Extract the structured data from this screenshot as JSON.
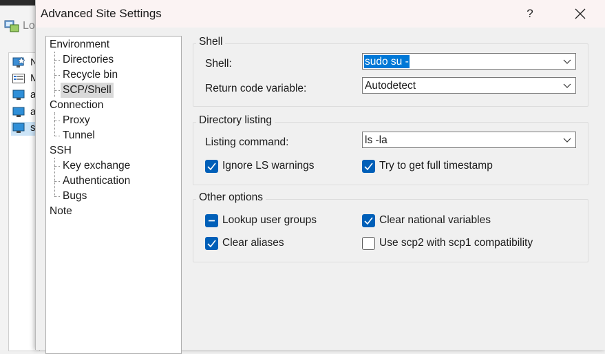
{
  "background_window": {
    "toolbar_login_label": "Lo",
    "list_items": [
      {
        "label": "N",
        "icon": "new-site-icon",
        "selected": false
      },
      {
        "label": "M",
        "icon": "manage-list-icon",
        "selected": false
      },
      {
        "label": "a",
        "icon": "computer-icon",
        "selected": false
      },
      {
        "label": "a",
        "icon": "computer-icon",
        "selected": false
      },
      {
        "label": "s",
        "icon": "computer-icon",
        "selected": true
      }
    ]
  },
  "dialog": {
    "title": "Advanced Site Settings",
    "help_label": "?",
    "tree": {
      "items": [
        {
          "label": "Environment",
          "level": 0
        },
        {
          "label": "Directories",
          "level": 1
        },
        {
          "label": "Recycle bin",
          "level": 1
        },
        {
          "label": "SCP/Shell",
          "level": 1,
          "selected": true
        },
        {
          "label": "Connection",
          "level": 0
        },
        {
          "label": "Proxy",
          "level": 1
        },
        {
          "label": "Tunnel",
          "level": 1
        },
        {
          "label": "SSH",
          "level": 0
        },
        {
          "label": "Key exchange",
          "level": 1
        },
        {
          "label": "Authentication",
          "level": 1
        },
        {
          "label": "Bugs",
          "level": 1
        },
        {
          "label": "Note",
          "level": 0
        }
      ]
    },
    "shell_group": {
      "title": "Shell",
      "shell_label": "Shell:",
      "shell_value": "sudo su -",
      "return_code_label": "Return code variable:",
      "return_code_value": "Autodetect"
    },
    "directory_group": {
      "title": "Directory listing",
      "listing_label": "Listing command:",
      "listing_value": "ls -la",
      "ignore_ls_label": "Ignore LS warnings",
      "ignore_ls_checked": true,
      "full_timestamp_label": "Try to get full timestamp",
      "full_timestamp_checked": true
    },
    "other_group": {
      "title": "Other options",
      "lookup_label": "Lookup user groups",
      "lookup_state": "indeterminate",
      "clear_national_label": "Clear national variables",
      "clear_national_checked": true,
      "clear_aliases_label": "Clear aliases",
      "clear_aliases_checked": true,
      "scp2_label": "Use scp2 with scp1 compatibility",
      "scp2_checked": false
    },
    "accent_color": "#005fb8",
    "selection_color": "#0078d7"
  }
}
